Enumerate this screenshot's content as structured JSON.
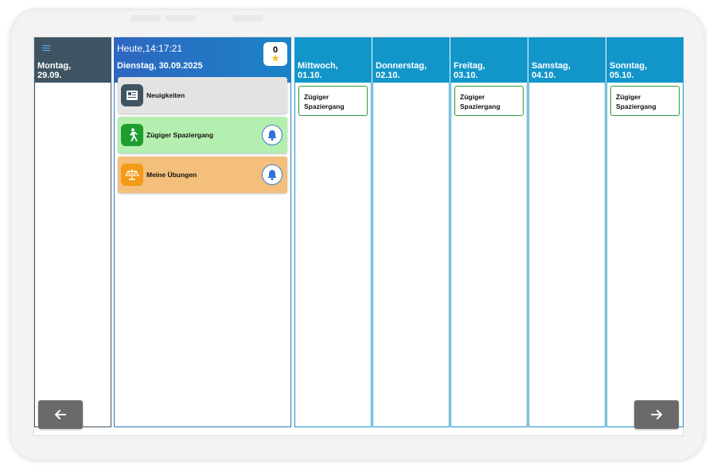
{
  "monday": {
    "day": "Montag,",
    "date": "29.09.",
    "menu_icon": "hamburger-icon"
  },
  "today": {
    "time": "Heute,14:17:21",
    "date": "Dienstag, 30.09.2025",
    "stars": {
      "count": "0",
      "icon": "star-icon"
    },
    "cards": [
      {
        "label": "Neuigkeiten",
        "icon": "newspaper-icon",
        "color": "#e3e3e3"
      },
      {
        "label": "Zügiger Spaziergang",
        "icon": "walking-icon",
        "color": "#b5efaf",
        "action_icon": "bell-icon"
      },
      {
        "label": "Meine Übungen",
        "icon": "scale-icon",
        "color": "#f4bf7b",
        "action_icon": "bell-icon"
      }
    ]
  },
  "days": [
    {
      "day": "Mittwoch,",
      "date": "01.10.",
      "task": "Zügiger\nSpaziergang"
    },
    {
      "day": "Donnerstag,",
      "date": "02.10.",
      "task": ""
    },
    {
      "day": "Freitag,",
      "date": "03.10.",
      "task": "Zügiger\nSpaziergang"
    },
    {
      "day": "Samstag,",
      "date": "04.10.",
      "task": ""
    },
    {
      "day": "Sonntag,",
      "date": "05.10.",
      "task": "Zügiger\nSpaziergang"
    }
  ],
  "nav": {
    "prev_icon": "arrow-left-icon",
    "next_icon": "arrow-right-icon"
  },
  "colors": {
    "monday_header": "#3f5463",
    "today_header": "#2e66c0",
    "day_header": "#1296ca",
    "task_border": "#2a9a3b"
  }
}
